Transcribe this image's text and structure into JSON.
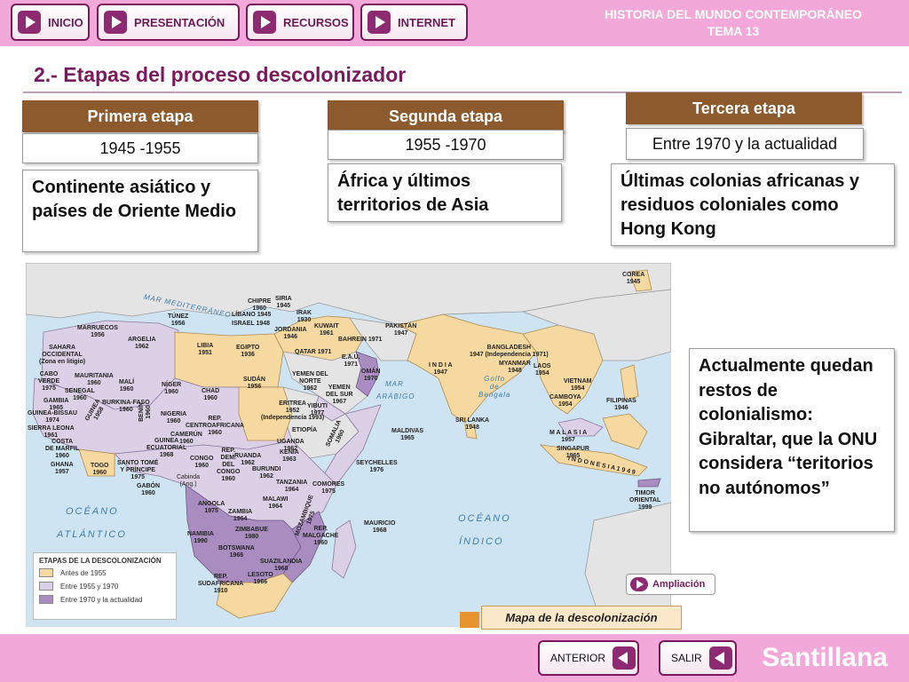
{
  "nav": {
    "inicio": "INICIO",
    "presentacion": "PRESENTACIÓN",
    "recursos": "RECURSOS",
    "internet": "INTERNET"
  },
  "header": {
    "line1": "HISTORIA DEL MUNDO CONTEMPORÁNEO",
    "line2": "TEMA 13"
  },
  "page_title": "2.- Etapas del proceso descolonizador",
  "stages": [
    {
      "name": "Primera etapa",
      "period": "1945 -1955",
      "description": "Continente asiático y países de Oriente Medio"
    },
    {
      "name": "Segunda etapa",
      "period": "1955 -1970",
      "description": "África y últimos territorios de Asia"
    },
    {
      "name": "Tercera etapa",
      "period": "Entre 1970 y la actualidad",
      "description": "Últimas colonias africanas y residuos coloniales como Hong Kong"
    }
  ],
  "note": "Actualmente quedan restos de colonialismo: Gibraltar, que la ONU considera “teritorios no autónomos”",
  "map": {
    "legend": {
      "title": "ETAPAS DE LA DESCOLONIZACIÓN",
      "items": [
        {
          "label": "Antes de 1955",
          "color": "#f6d9a0"
        },
        {
          "label": "Entre 1955 y 1970",
          "color": "#dcd0e6"
        },
        {
          "label": "Entre 1970 y la actualidad",
          "color": "#a98cc0"
        }
      ]
    },
    "oceans": {
      "atlantic_1": "OCÉANO",
      "atlantic_2": "ATLÁNTICO",
      "indian_1": "OCÉANO",
      "indian_2": "ÍNDICO"
    },
    "seas": {
      "med": "MAR MEDITERRÁNEO",
      "arab_1": "MAR",
      "arab_2": "ARÁBIGO",
      "bengal": "Golfo\nde\nBengala"
    },
    "labels": {
      "marruecos": "MARRUECOS\n1956",
      "sahara": "SAHARA\nOCCIDENTAL\n(Zona en litigio)",
      "argelia": "ARGELIA\n1962",
      "tunez": "TÚNEZ\n1956",
      "libia": "LIBIA\n1951",
      "egipto": "EGIPTO\n1936",
      "chipre": "CHIPRE\n1960",
      "libano": "LÍBANO 1945",
      "israel": "ISRAEL 1948",
      "siria": "SIRIA\n1945",
      "jordania": "JORDANIA\n1946",
      "irak": "IRAK\n1930",
      "kuwait": "KUWAIT\n1961",
      "bahrein": "BAHREIN 1971",
      "qatar": "QATAR 1971",
      "eau": "E.A.U.\n1971",
      "oman": "OMÁN\n1970",
      "yemen_norte": "YEMEN DEL\nNORTE\n1962",
      "yemen_sur": "YEMEN\nDEL SUR\n1967",
      "cabo_verde": "CABO\nVERDE\n1975",
      "mauritania": "MAURITANIA\n1960",
      "senegal": "SENEGAL\n1960",
      "mali": "MALÍ\n1960",
      "niger": "NÍGER\n1960",
      "chad": "CHAD\n1960",
      "sudan": "SUDÁN\n1956",
      "eritrea": "ERITREA\n1952\n(Independencia 1993)",
      "yibuti": "YIBUTI\n1977",
      "gambia": "GAMBIA\n1965",
      "guinea_bissau": "GUINEA-BISSAU\n1974",
      "guinea": "GUINEA\n1958",
      "sierra_leona": "SIERRA LEONA\n1961",
      "burkina": "BURKINA-FASO\n1960",
      "nigeria": "NIGERIA\n1960",
      "rca": "REP.\nCENTROAFRICANA\n1960",
      "etiopia": "ETIOPÍA",
      "somalia": "SOMALIA\n1960",
      "costa_marfil": "COSTA\nDE MARFIL\n1960",
      "ghana": "GHANA\n1957",
      "togo": "TOGO\n1960",
      "benin": "BENÍN\n1960",
      "camerun": "CAMERÚN\n1960",
      "guinea_ecuatorial": "GUINEA\nECUATORIAL\n1968",
      "santo_tome": "SANTO TOMÉ\nY PRÍNCIPE\n1975",
      "gabon": "GABÓN\n1960",
      "congo": "CONGO\n1960",
      "rdc": "REP.\nDEM.\nDEL\nCONGO\n1960",
      "cabinda": "Cabinda\n(Ang.)",
      "uganda": "UGANDA\n1962",
      "kenia": "KENIA\n1963",
      "ruanda": "RUANDA\n1962",
      "burundi": "BURUNDI\n1962",
      "tanzania": "TANZANIA\n1964",
      "angola": "ANGOLA\n1975",
      "zambia": "ZAMBIA\n1964",
      "malawi": "MALAWI\n1964",
      "mozambique": "MOZAMBIQUE\n1975",
      "zimbabue": "ZIMBABUE\n1980",
      "namibia": "NAMIBIA\n1990",
      "botswana": "BOTSWANA\n1966",
      "suazilandia": "SUAZILANDIA\n1968",
      "lesoto": "LESOTO\n1966",
      "sudafrica": "REP.\nSUDAFRICANA\n1910",
      "madagascar": "REP.\nMALGACHE\n1960",
      "comores": "COMORES\n1975",
      "seychelles": "SEYCHELLES\n1976",
      "mauricio": "MAURICIO\n1968",
      "maldivas": "MALDIVAS\n1965",
      "pakistan": "PAKISTÁN\n1947",
      "india": "I N D I A\n1947",
      "bangladesh": "BANGLADESH\n1947 (Independencia 1971)",
      "sri_lanka": "SRI LANKA\n1948",
      "myanmar": "MYANMAR\n1948",
      "laos": "LAOS\n1954",
      "vietnam": "VIETNAM\n1954",
      "camboya": "CAMBOYA\n1954",
      "filipinas": "FILIPINAS\n1946",
      "malasia": "M A L A S I A\n1957",
      "singapur": "SINGAPUR\n1965",
      "indonesia": "I N D O N E S I A  1 9 4 9",
      "timor": "TIMOR\nORIENTAL\n1999",
      "corea": "COREA\n1945"
    }
  },
  "ampliacion": "Ampliación",
  "map_caption": "Mapa de la descolonización",
  "footer": {
    "anterior": "ANTERIOR",
    "salir": "SALIR",
    "brand": "Santillana"
  }
}
